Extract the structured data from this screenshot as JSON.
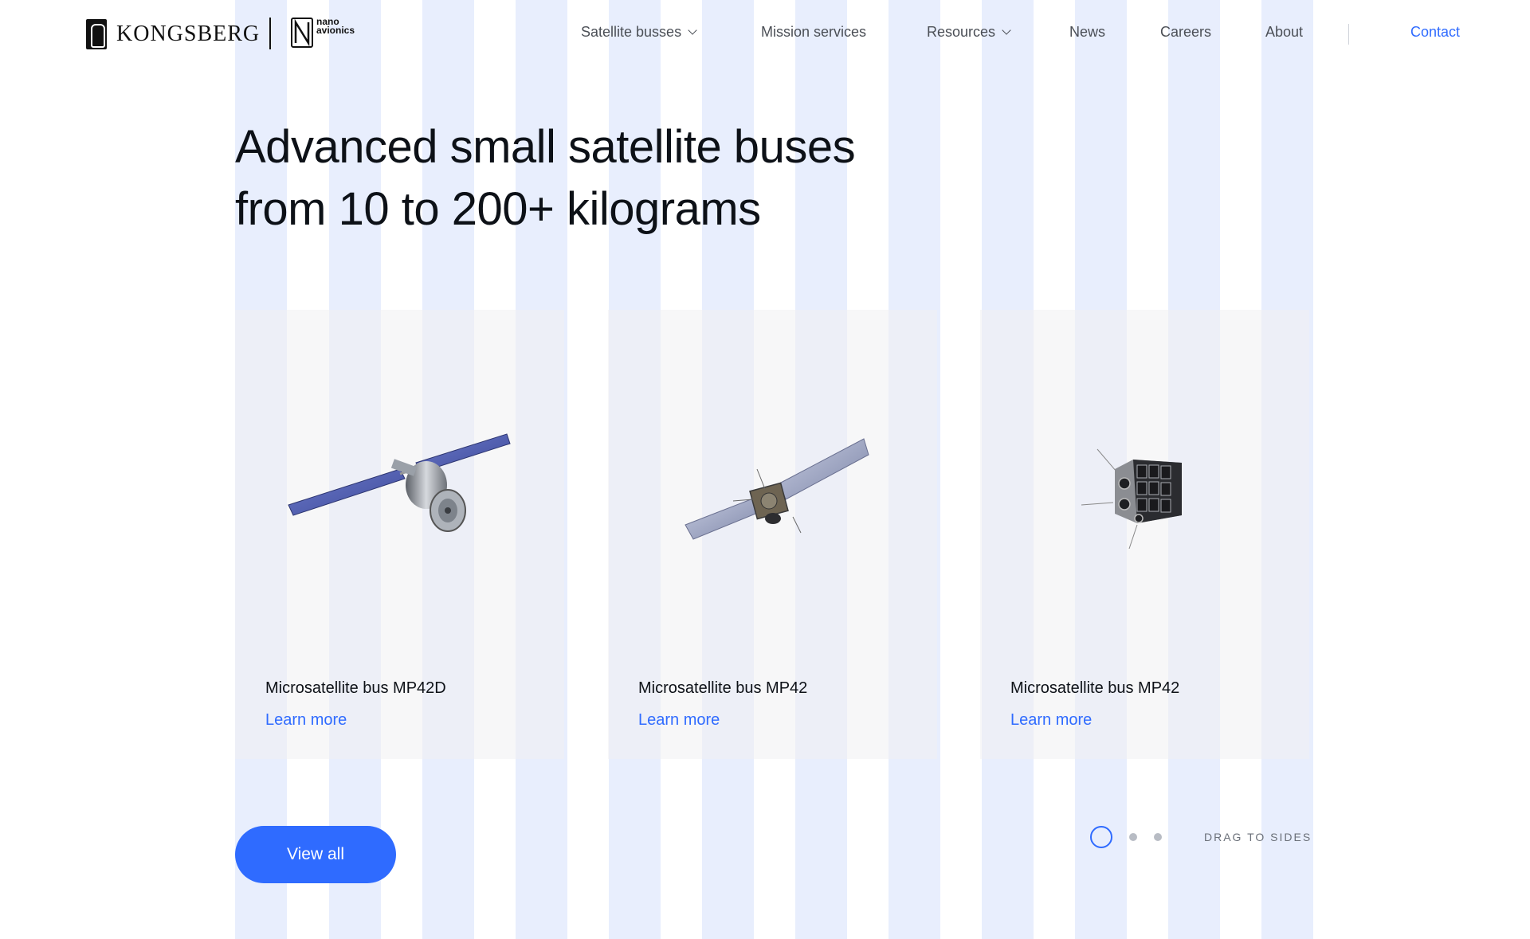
{
  "header": {
    "brand": "KONGSBERG",
    "sub_brand_line1": "nano",
    "sub_brand_line2": "avionics",
    "nav": [
      {
        "label": "Satellite busses",
        "has_dropdown": true
      },
      {
        "label": "Mission services",
        "has_dropdown": false
      },
      {
        "label": "Resources",
        "has_dropdown": true
      },
      {
        "label": "News",
        "has_dropdown": false
      },
      {
        "label": "Careers",
        "has_dropdown": false
      },
      {
        "label": "About",
        "has_dropdown": false
      }
    ],
    "contact": "Contact"
  },
  "hero": {
    "headline_line1": "Advanced small satellite buses",
    "headline_line2": "from 10 to 200+ kilograms"
  },
  "cards": [
    {
      "title": "Microsatellite bus MP42D",
      "link": "Learn more",
      "icon": "satellite-dish-icon"
    },
    {
      "title": "Microsatellite bus MP42",
      "link": "Learn more",
      "icon": "satellite-panel-icon"
    },
    {
      "title": "Microsatellite bus MP42",
      "link": "Learn more",
      "icon": "cubesat-icon"
    }
  ],
  "controls": {
    "view_all": "View all",
    "drag_hint": "DRAG TO SIDES",
    "active_slide": 1,
    "slide_count": 3
  },
  "colors": {
    "accent": "#2f6bff",
    "grid": "#e8eefd",
    "text": "#0d1117"
  }
}
